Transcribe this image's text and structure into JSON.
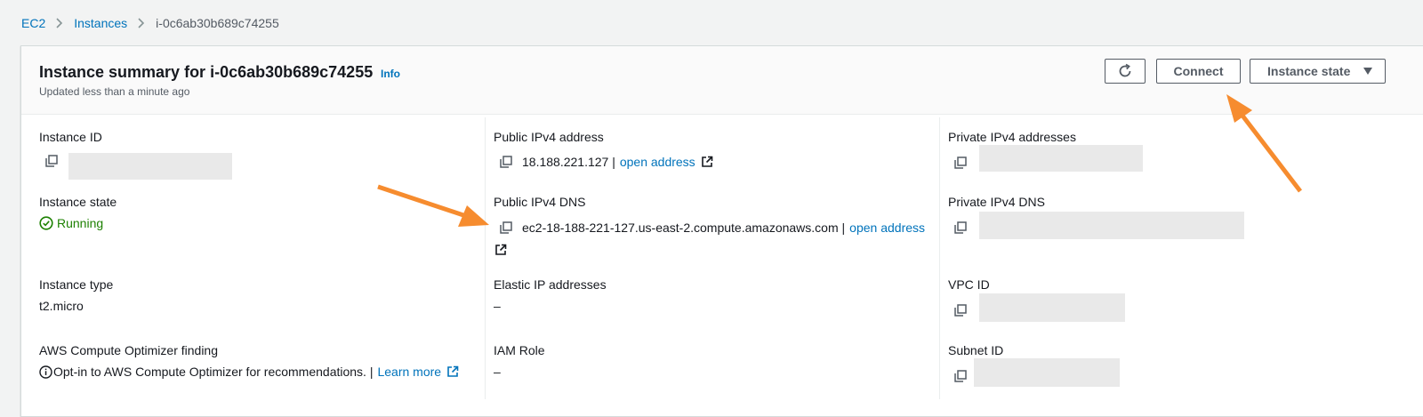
{
  "breadcrumb": {
    "items": [
      {
        "label": "EC2"
      },
      {
        "label": "Instances"
      }
    ],
    "current": "i-0c6ab30b689c74255"
  },
  "header": {
    "title": "Instance summary for i-0c6ab30b689c74255",
    "info_label": "Info",
    "subtitle": "Updated less than a minute ago",
    "connect_label": "Connect",
    "instance_state_label": "Instance state",
    "refresh_icon": "refresh-icon"
  },
  "fields": {
    "instance_id": {
      "label": "Instance ID"
    },
    "instance_state": {
      "label": "Instance state",
      "value": "Running"
    },
    "instance_type": {
      "label": "Instance type",
      "value": "t2.micro"
    },
    "optimizer": {
      "label": "AWS Compute Optimizer finding",
      "text": "Opt-in to AWS Compute Optimizer for recommendations. |",
      "link": "Learn more"
    },
    "public_ipv4": {
      "label": "Public IPv4 address",
      "value": "18.188.221.127 |",
      "link": "open address"
    },
    "public_dns": {
      "label": "Public IPv4 DNS",
      "value": "ec2-18-188-221-127.us-east-2.compute.amazonaws.com |",
      "link": "open address"
    },
    "elastic_ip": {
      "label": "Elastic IP addresses",
      "value": "–"
    },
    "iam_role": {
      "label": "IAM Role",
      "value": "–"
    },
    "private_ipv4": {
      "label": "Private IPv4 addresses"
    },
    "private_dns": {
      "label": "Private IPv4 DNS"
    },
    "vpc_id": {
      "label": "VPC ID"
    },
    "subnet_id": {
      "label": "Subnet ID"
    }
  },
  "colors": {
    "link": "#0073bb",
    "running": "#1d8102",
    "annotation_arrow": "#f68c2f"
  }
}
